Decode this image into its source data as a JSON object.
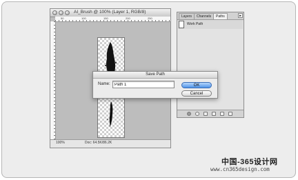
{
  "document": {
    "title": "AI_Brush @ 100% (Layer 1, RGB/8)",
    "zoom": "100%",
    "doc_info": "Doc: 64.5K/86.2K",
    "ruler_top_labels": [
      "50",
      "100",
      "150",
      "200",
      "250"
    ],
    "ruler_left_labels": [
      "0",
      "5",
      "1",
      "0",
      "1",
      "5",
      "2",
      "0"
    ]
  },
  "panel": {
    "tabs": [
      "Layers",
      "Channels",
      "Paths"
    ],
    "active_tab": "Paths",
    "path_item": "Work Path"
  },
  "dialog": {
    "title": "Save Path",
    "name_label": "Name:",
    "name_value": "Path 1",
    "ok_label": "OK",
    "cancel_label": "Cancel"
  },
  "watermark": {
    "line1": "中国-365设计网",
    "line2": "www.cn365design.com"
  },
  "colors": {
    "ok_button": "#4f94e8",
    "canvas_bg": "#bdbdbd"
  }
}
